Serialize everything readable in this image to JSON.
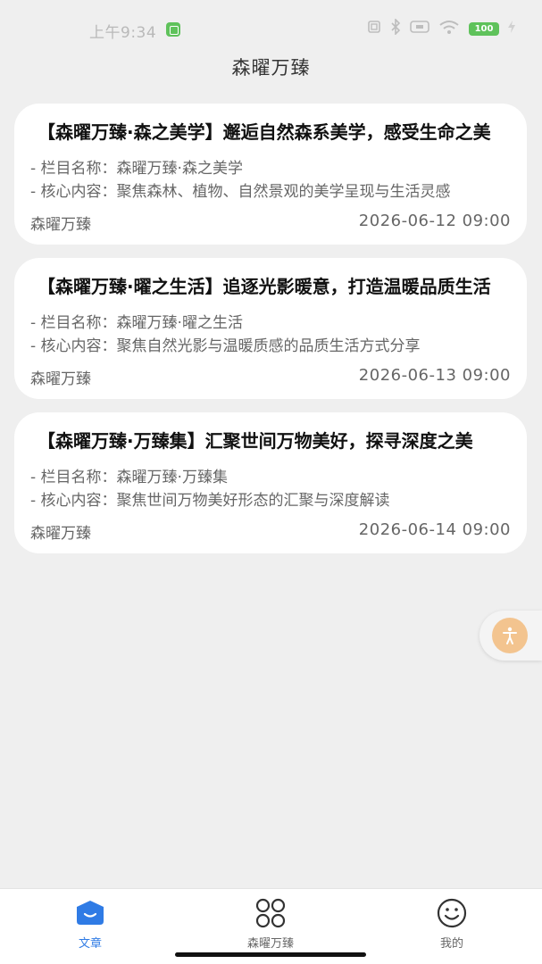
{
  "status_bar": {
    "time": "上午9:34",
    "battery": "100"
  },
  "header": {
    "title": "森曜万臻"
  },
  "articles": [
    {
      "title": "【森曜万臻·森之美学】邂逅自然森系美学，感受生命之美",
      "column_line": "- 栏目名称：森曜万臻·森之美学",
      "content_line": "- 核心内容：聚焦森林、植物、自然景观的美学呈现与生活灵感",
      "source": "森曜万臻",
      "date": "2026-06-12 09:00"
    },
    {
      "title": "【森曜万臻·曜之生活】追逐光影暖意，打造温暖品质生活",
      "column_line": "- 栏目名称：森曜万臻·曜之生活",
      "content_line": "- 核心内容：聚焦自然光影与温暖质感的品质生活方式分享",
      "source": "森曜万臻",
      "date": "2026-06-13 09:00"
    },
    {
      "title": "【森曜万臻·万臻集】汇聚世间万物美好，探寻深度之美",
      "column_line": "- 栏目名称：森曜万臻·万臻集",
      "content_line": "- 核心内容：聚焦世间万物美好形态的汇聚与深度解读",
      "source": "森曜万臻",
      "date": "2026-06-14 09:00"
    }
  ],
  "bottom_nav": {
    "items": [
      {
        "label": "文章",
        "icon": "article-icon",
        "active": true
      },
      {
        "label": "森曜万臻",
        "icon": "grid-icon",
        "active": false
      },
      {
        "label": "我的",
        "icon": "smiley-icon",
        "active": false
      }
    ]
  },
  "colors": {
    "accent": "#2f7be5",
    "background": "#efefef",
    "float_button": "#f3c48f"
  }
}
